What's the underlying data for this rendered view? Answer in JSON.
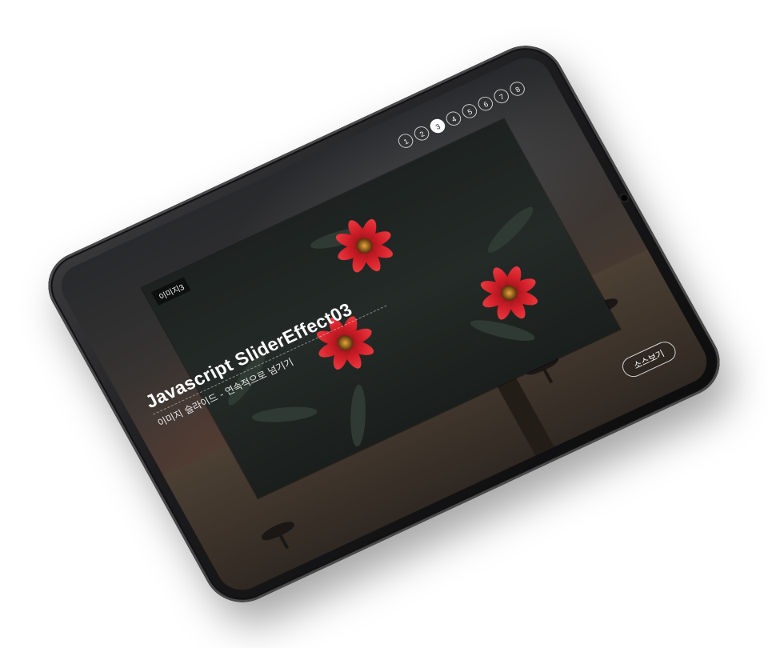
{
  "header": {
    "title": "Javascript SliderEffect03",
    "subtitle": "이미지 슬라이드 - 연속적으로 넘기기"
  },
  "pager": {
    "pages": [
      "1",
      "2",
      "3",
      "4",
      "5",
      "6",
      "7",
      "8"
    ],
    "active_index": 2
  },
  "slide": {
    "label": "이미지3",
    "image_subject": "red dahlia flowers on dark foliage"
  },
  "buttons": {
    "source_label": "소스보기"
  },
  "colors": {
    "petal": "#d4202a",
    "background": "#2c2d30",
    "text": "#ffffff"
  }
}
